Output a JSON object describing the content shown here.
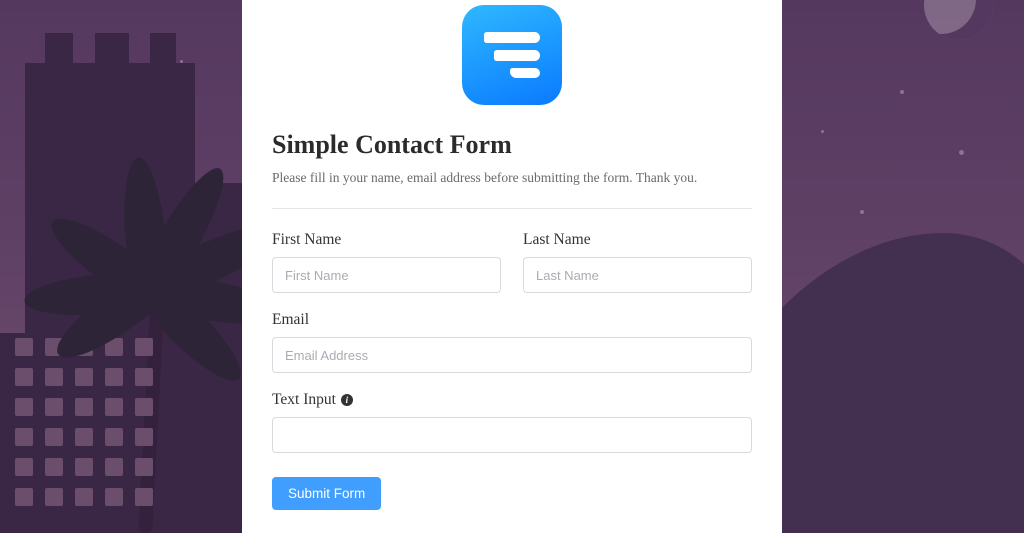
{
  "form": {
    "title": "Simple Contact Form",
    "description": "Please fill in your name, email address before submitting the form. Thank you.",
    "fields": {
      "first_name": {
        "label": "First Name",
        "placeholder": "First Name"
      },
      "last_name": {
        "label": "Last Name",
        "placeholder": "Last Name"
      },
      "email": {
        "label": "Email",
        "placeholder": "Email Address"
      },
      "text_input": {
        "label": "Text Input",
        "placeholder": ""
      }
    },
    "submit_label": "Submit Form"
  }
}
